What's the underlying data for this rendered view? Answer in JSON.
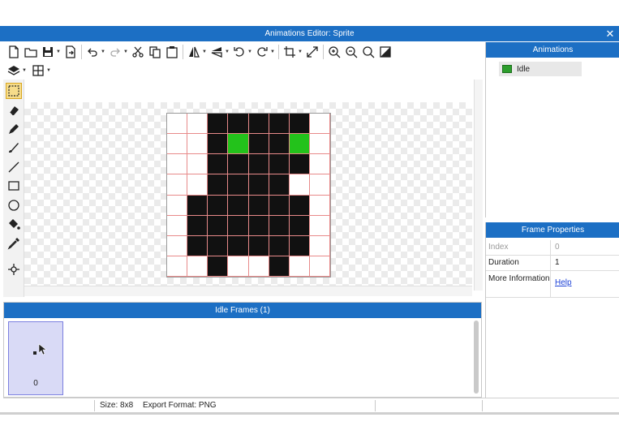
{
  "window": {
    "title": "Animations Editor: Sprite",
    "close_glyph": "✕"
  },
  "toolbar": {
    "row1": [
      {
        "name": "new-file-icon"
      },
      {
        "name": "open-folder-icon"
      },
      {
        "name": "save-icon",
        "drop": true
      },
      {
        "name": "export-icon"
      },
      {
        "name": "undo-icon",
        "drop": true
      },
      {
        "name": "redo-icon",
        "drop": true
      },
      {
        "name": "cut-icon"
      },
      {
        "name": "copy-icon"
      },
      {
        "name": "paste-icon"
      },
      {
        "name": "flip-horizontal-icon",
        "drop": true
      },
      {
        "name": "flip-vertical-icon",
        "drop": true
      },
      {
        "name": "rotate-left-icon",
        "drop": true
      },
      {
        "name": "rotate-right-icon",
        "drop": true
      },
      {
        "name": "crop-icon",
        "drop": true
      },
      {
        "name": "resize-icon"
      },
      {
        "name": "zoom-in-icon"
      },
      {
        "name": "zoom-out-icon"
      },
      {
        "name": "zoom-fit-icon"
      },
      {
        "name": "contrast-icon"
      }
    ],
    "row2": [
      {
        "name": "layers-icon",
        "drop": true
      },
      {
        "name": "grid-icon",
        "drop": true
      }
    ]
  },
  "tools": [
    {
      "name": "select-rect-tool",
      "selected": true
    },
    {
      "name": "eraser-tool"
    },
    {
      "name": "pencil-tool"
    },
    {
      "name": "brush-tool"
    },
    {
      "name": "line-tool"
    },
    {
      "name": "rectangle-tool"
    },
    {
      "name": "ellipse-tool"
    },
    {
      "name": "fill-bucket-tool"
    },
    {
      "name": "eyedropper-tool"
    },
    {
      "name": "pivot-tool"
    }
  ],
  "sprite": {
    "size": 8,
    "colors": {
      "k": "#111111",
      "g": "#23c21b"
    },
    "pixels": [
      "..kkkkk.",
      "..kgkkg.",
      "..kkkkk.",
      "..kkkk..",
      ".kkkkkk.",
      ".kkkkkk.",
      ".kkkkkk.",
      "..k..k.."
    ]
  },
  "animations_panel": {
    "title": "Animations",
    "items": [
      {
        "label": "Idle"
      }
    ]
  },
  "frame_properties": {
    "title": "Frame Properties",
    "rows": [
      {
        "key": "Index",
        "value": "0",
        "dim": true
      },
      {
        "key": "Duration",
        "value": "1"
      },
      {
        "key": "More Information",
        "value": "Help",
        "link": true
      }
    ]
  },
  "frames_panel": {
    "title": "Idle Frames (1)",
    "frames": [
      {
        "index": "0"
      }
    ]
  },
  "status": {
    "size": "Size: 8x8",
    "format": "Export Format: PNG"
  },
  "colors": {
    "accent": "#1c6fc4",
    "selection": "#f6dc8a",
    "frame_selected": "#d9daf6"
  }
}
